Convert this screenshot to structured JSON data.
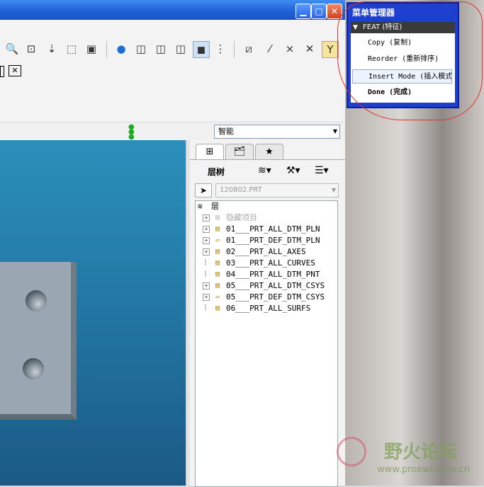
{
  "window": {
    "min_icon": "minimize-icon",
    "max_icon": "maximize-icon",
    "close_icon": "close-icon"
  },
  "toolbar": {
    "smart_filter": "智能",
    "icons": [
      "zoom-area-icon",
      "zoom-window-icon",
      "reorient-icon",
      "annotation-icon",
      "datum-display-icon",
      "spin-center-icon",
      "view-standard-icon",
      "view-front-icon",
      "view-iso-icon",
      "view-shaded-icon",
      "tree-columns-icon",
      "plane-display-icon",
      "axis-display-icon",
      "point-display-icon",
      "csys-display-icon",
      "filter-icon"
    ]
  },
  "navigator": {
    "tabs": [
      "tree-tab-icon",
      "folder-tab-icon",
      "favorites-tab-icon"
    ],
    "layer_tree_label": "层树",
    "model_select": "120802.PRT",
    "root_label": "层",
    "items": [
      {
        "label": "隐藏项目",
        "muted": true,
        "expandable": true
      },
      {
        "label": "01___PRT_ALL_DTM_PLN",
        "expandable": true
      },
      {
        "label": "01___PRT_DEF_DTM_PLN",
        "expandable": true
      },
      {
        "label": "02___PRT_ALL_AXES",
        "expandable": true
      },
      {
        "label": "03___PRT_ALL_CURVES",
        "expandable": false
      },
      {
        "label": "04___PRT_ALL_DTM_PNT",
        "expandable": false
      },
      {
        "label": "05___PRT_ALL_DTM_CSYS",
        "expandable": true
      },
      {
        "label": "05___PRT_DEF_DTM_CSYS",
        "expandable": true
      },
      {
        "label": "06___PRT_ALL_SURFS",
        "expandable": false
      }
    ]
  },
  "menu_manager": {
    "title": "菜单管理器",
    "section": "FEAT (特征)",
    "items": [
      {
        "label": "Copy (复制)"
      },
      {
        "label": "Reorder (重新排序)"
      },
      {
        "label": "Insert Mode (插入模式"
      },
      {
        "label": "Done (完成)",
        "bold": true
      }
    ]
  },
  "watermark": {
    "cn": "野火论坛",
    "url": "www.proewildfire.cn"
  },
  "colors": {
    "title_blue": "#1f5fd6",
    "menu_blue": "#1f3fcf",
    "viewport_top": "#2b8fbb",
    "annotation_red": "#e03030"
  }
}
